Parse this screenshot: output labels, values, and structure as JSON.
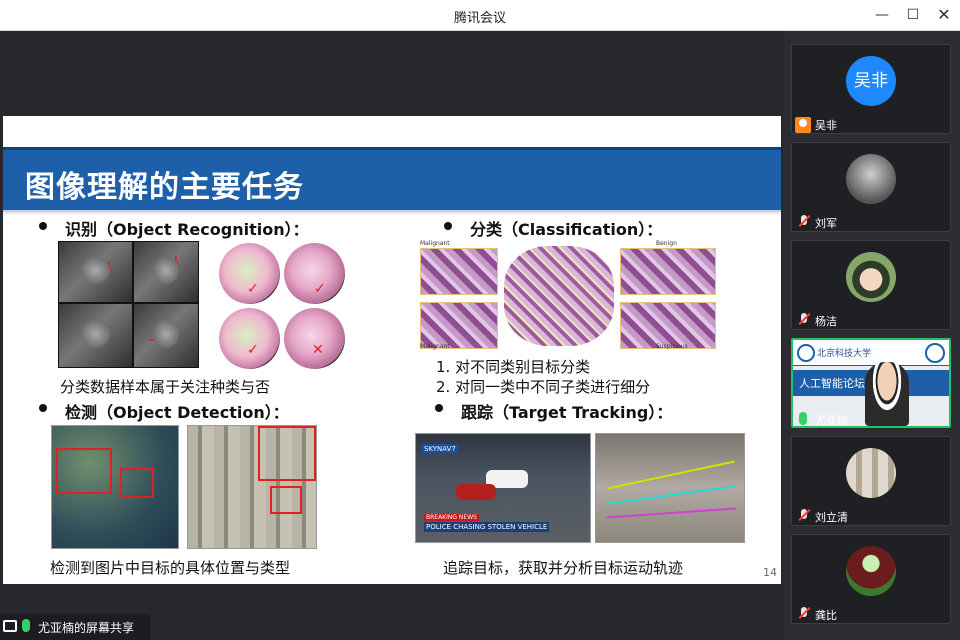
{
  "window": {
    "title": "腾讯会议"
  },
  "slide": {
    "title": "图像理解的主要任务",
    "page_number": "14",
    "sections": {
      "recognition": {
        "title": "识别（Object Recognition）：",
        "caption": "分类数据样本属于关注种类与否"
      },
      "classification": {
        "title": "分类（Classification）：",
        "items": [
          "1.   对不同类别目标分类",
          "2.   对同一类中不同子类进行细分"
        ],
        "figure_labels": {
          "top_left": "Malignant",
          "top_right": "Benign",
          "bottom_left": "Malignant",
          "bottom_right": "Suspicious"
        }
      },
      "detection": {
        "title": "检测（Object Detection）：",
        "caption": "检测到图片中目标的具体位置与类型"
      },
      "tracking": {
        "title": "跟踪（Target Tracking）：",
        "caption": "追踪目标，获取并分析目标运动轨迹",
        "figure_text": {
          "badge": "SKYNAV7",
          "banner_top": "BREAKING NEWS",
          "banner_main": "POLICE CHASING STOLEN VEHICLE"
        }
      }
    }
  },
  "screen_share": {
    "label": "尤亚楠的屏幕共享"
  },
  "participants": [
    {
      "name": "吴非",
      "avatar_text": "吴非",
      "avatar_color": "#1e88ff"
    },
    {
      "name": "刘军"
    },
    {
      "name": "杨洁"
    },
    {
      "name": "尤亚楠",
      "video_banner": "人工智能论坛",
      "video_header": "北京科技大学"
    },
    {
      "name": "刘立清"
    },
    {
      "name": "龚比"
    }
  ],
  "colors": {
    "accent_blue": "#1d5fa8",
    "active_green": "#27c06a",
    "mute_red": "#ff3b30",
    "mark_red": "#e12020"
  }
}
